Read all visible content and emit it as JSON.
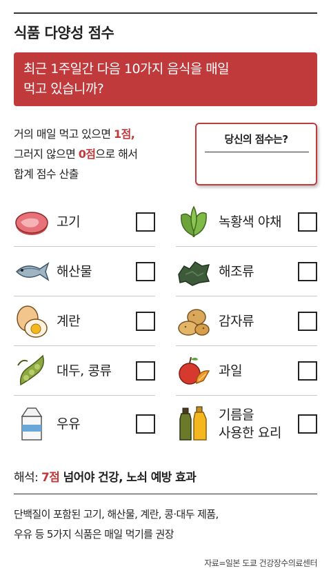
{
  "title": "식품 다양성 점수",
  "question": {
    "line1": "최근 1주일간 다음 10가지 음식을 매일",
    "line2": "먹고 있습니까?"
  },
  "instructions": {
    "line1_a": "거의 매일 먹고 있으면 ",
    "line1_b": "1점",
    "line1_c": ",",
    "line2_a": "그러지 않으면 ",
    "line2_b": "0점",
    "line2_c": "으로 해서",
    "line3": "합계 점수 산출"
  },
  "score_box": {
    "title": "당신의 점수는?"
  },
  "items": [
    {
      "label": "고기",
      "icon": "meat-icon"
    },
    {
      "label": "녹황색 야채",
      "icon": "leafy-greens-icon"
    },
    {
      "label": "해산물",
      "icon": "fish-icon"
    },
    {
      "label": "해조류",
      "icon": "seaweed-icon"
    },
    {
      "label": "계란",
      "icon": "eggs-icon"
    },
    {
      "label": "감자류",
      "icon": "potatoes-icon"
    },
    {
      "label": "대두, 콩류",
      "icon": "soybean-icon"
    },
    {
      "label": "과일",
      "icon": "fruit-icon"
    },
    {
      "label": "우유",
      "icon": "milk-carton-icon"
    },
    {
      "label_line1": "기름을",
      "label_line2": "사용한 요리",
      "icon": "oil-bottles-icon"
    }
  ],
  "interpretation": {
    "prefix": "해석: ",
    "highlight": "7점",
    "rest": " 넘어야 건강, 노쇠 예방 효과"
  },
  "note": {
    "line1": "단백질이 포함된 고기, 해산물, 계란, 콩·대두 제품,",
    "line2": "우유 등 5가지 식품은 매일 먹기를 권장"
  },
  "source": "자료=일본 도쿄 건강장수의료센터",
  "colors": {
    "accent": "#c0393b",
    "text": "#222222",
    "divider": "#c9c9c9"
  }
}
